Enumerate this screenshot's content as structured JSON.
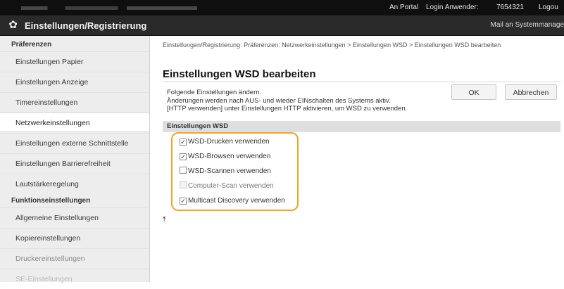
{
  "header": {
    "portal_link": "An Portal",
    "login_label": "Login Anwender:",
    "login_user": "7654321",
    "logout_label": "Logou",
    "title": "Einstellungen/Registrierung",
    "mail_link": "Mail an Systemmanage"
  },
  "sidebar": {
    "section_prefs": "Präferenzen",
    "items": [
      {
        "label": "Einstellungen Papier"
      },
      {
        "label": "Einstellungen Anzeige"
      },
      {
        "label": "Timereinstellungen"
      },
      {
        "label": "Netzwerkeinstellungen"
      },
      {
        "label": "Einstellungen externe Schnittstelle"
      },
      {
        "label": "Einstellungen Barrierefreiheit"
      },
      {
        "label": "Lautstärkeregelung"
      }
    ],
    "section_functions": "Funktionseinstellungen",
    "function_items": [
      {
        "label": "Allgemeine Einstellungen"
      },
      {
        "label": "Kopiereinstellungen"
      },
      {
        "label": "Druckereinstellungen"
      },
      {
        "label": "SE-Einstellungen"
      }
    ],
    "active_index": 3
  },
  "main": {
    "breadcrumb": "Einstellungen/Registrierung: Präferenzen: Netzwerkeinstellungen > Einstellungen WSD > Einstellungen WSD bearbeiten",
    "title": "Einstellungen WSD bearbeiten",
    "description": [
      "Folgende Einstellungen ändern.",
      "Änderungen werden nach AUS- und wieder EINschalten des Systems aktiv.",
      "[HTTP verwenden] unter Einstellungen HTTP aktivieren, um WSD zu verwenden."
    ],
    "ok_button": "OK",
    "cancel_button": "Abbrechen",
    "section_title": "Einstellungen WSD",
    "options": [
      {
        "label": "WSD-Drucken verwenden",
        "checked": true,
        "enabled": true
      },
      {
        "label": "WSD-Browsen verwenden",
        "checked": true,
        "enabled": true
      },
      {
        "label": "WSD-Scannen verwenden",
        "checked": false,
        "enabled": true
      },
      {
        "label": "Computer-Scan verwenden",
        "checked": false,
        "enabled": false
      },
      {
        "label": "Multicast Discovery verwenden",
        "checked": true,
        "enabled": true
      }
    ],
    "highlight_color": "#f3a32c"
  }
}
